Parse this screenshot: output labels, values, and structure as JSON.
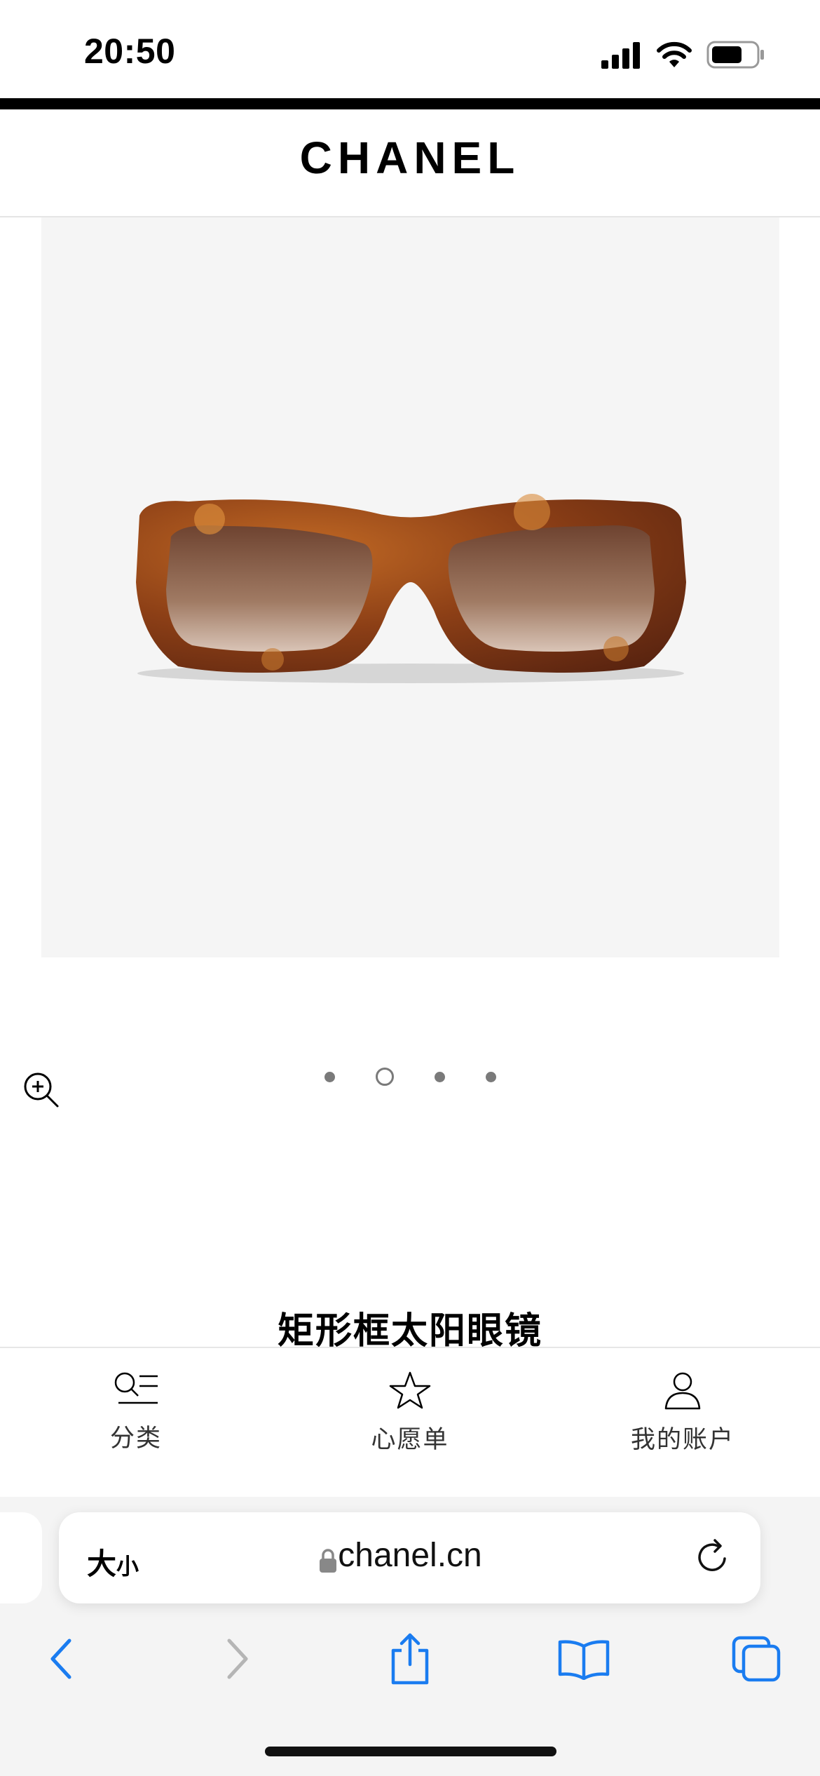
{
  "status_bar": {
    "time": "20:50",
    "icons": [
      "signal-icon",
      "wifi-icon",
      "battery-icon"
    ]
  },
  "brand": {
    "logo": "CHANEL"
  },
  "gallery": {
    "dots": 4,
    "active_index": 1
  },
  "product": {
    "title": "矩形框太阳眼镜"
  },
  "bottom_nav": {
    "items": [
      {
        "label": "分类",
        "icon": "category-list-icon"
      },
      {
        "label": "心愿单",
        "icon": "star-icon"
      },
      {
        "label": "我的账户",
        "icon": "user-icon"
      }
    ]
  },
  "browser": {
    "text_size_big": "大",
    "text_size_small": "小",
    "url": "chanel.cn",
    "icons": [
      "lock-icon",
      "reload-icon",
      "back-icon",
      "forward-icon",
      "share-icon",
      "bookmarks-icon",
      "tabs-icon"
    ],
    "accent": "#1a7cf0"
  }
}
